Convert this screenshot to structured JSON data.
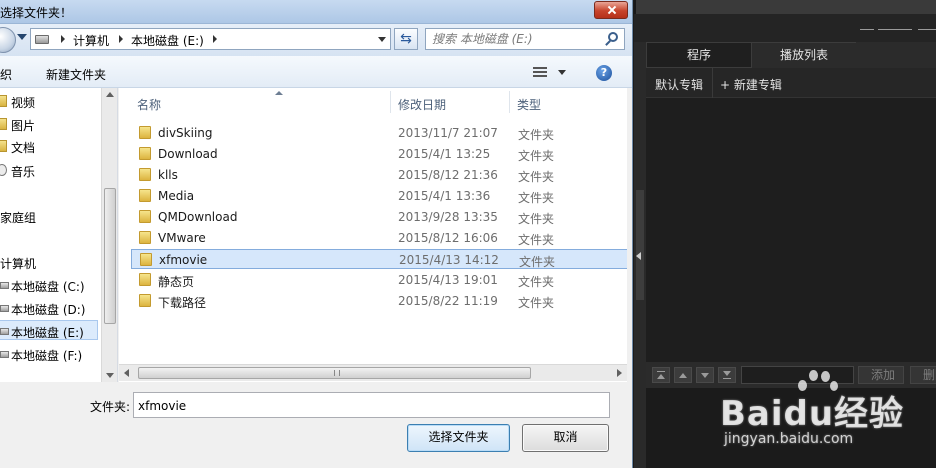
{
  "dialog": {
    "title": "选择文件夹！",
    "breadcrumb": [
      "计算机",
      "本地磁盘 (E:)"
    ],
    "search_placeholder": "搜索 本地磁盘 (E:)",
    "toolbar": {
      "organize_label": "织",
      "new_folder_label": "新建文件夹"
    },
    "nav": {
      "items": [
        {
          "label": "视频",
          "icon": "folder-icon",
          "selected": false
        },
        {
          "label": "图片",
          "icon": "folder-icon",
          "selected": false
        },
        {
          "label": "文档",
          "icon": "folder-icon",
          "selected": false
        },
        {
          "label": "音乐",
          "icon": "music-icon",
          "selected": false
        },
        {
          "label": "家庭组",
          "icon": "homegroup-icon",
          "selected": false
        },
        {
          "label": "计算机",
          "icon": "computer-icon",
          "selected": false
        },
        {
          "label": "本地磁盘 (C:)",
          "icon": "drive-icon",
          "selected": false
        },
        {
          "label": "本地磁盘 (D:)",
          "icon": "drive-icon",
          "selected": false
        },
        {
          "label": "本地磁盘 (E:)",
          "icon": "drive-icon",
          "selected": true
        },
        {
          "label": "本地磁盘 (F:)",
          "icon": "drive-icon",
          "selected": false
        }
      ]
    },
    "columns": {
      "name": "名称",
      "modified": "修改日期",
      "type": "类型"
    },
    "files": [
      {
        "name": "divSkiing",
        "modified": "2013/11/7 21:07",
        "type": "文件夹",
        "selected": false
      },
      {
        "name": "Download",
        "modified": "2015/4/1 13:25",
        "type": "文件夹",
        "selected": false
      },
      {
        "name": "klls",
        "modified": "2015/8/12 21:36",
        "type": "文件夹",
        "selected": false
      },
      {
        "name": "Media",
        "modified": "2015/4/1 13:36",
        "type": "文件夹",
        "selected": false
      },
      {
        "name": "QMDownload",
        "modified": "2013/9/28 13:35",
        "type": "文件夹",
        "selected": false
      },
      {
        "name": "VMware",
        "modified": "2015/8/12 16:06",
        "type": "文件夹",
        "selected": false
      },
      {
        "name": "xfmovie",
        "modified": "2015/4/13 14:12",
        "type": "文件夹",
        "selected": true
      },
      {
        "name": "静态页",
        "modified": "2015/4/13 19:01",
        "type": "文件夹",
        "selected": false
      },
      {
        "name": "下载路径",
        "modified": "2015/8/22 11:19",
        "type": "文件夹",
        "selected": false
      }
    ],
    "folder_field": {
      "label": "文件夹:",
      "value": "xfmovie"
    },
    "buttons": {
      "select_label": "选择文件夹",
      "cancel_label": "取消"
    }
  },
  "app": {
    "tabs": {
      "program": "程序",
      "playlist": "播放列表"
    },
    "subtabs": {
      "default_album": "默认专辑",
      "new_album": "+ 新建专辑"
    },
    "controls": {
      "add": "添加",
      "delete": "删除"
    }
  },
  "watermark": {
    "brand": "Baidu经验",
    "url": "jingyan.baidu.com"
  }
}
